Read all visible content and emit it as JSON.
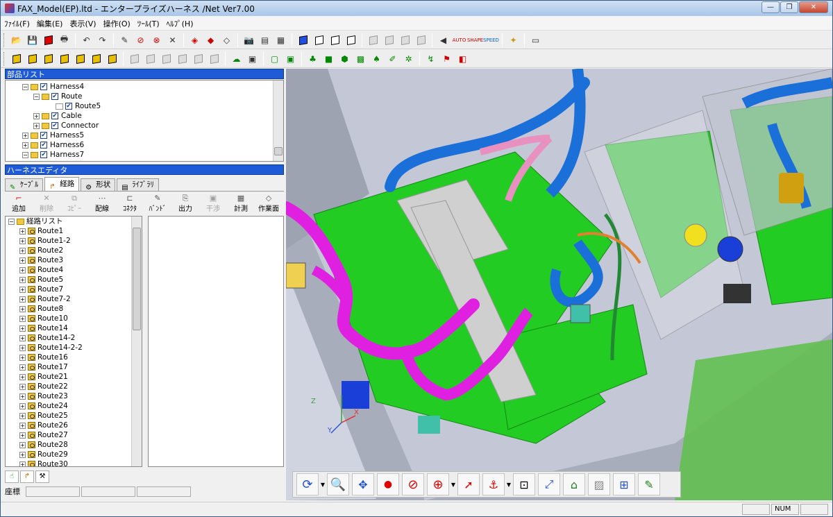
{
  "window": {
    "title": "FAX_Model(EP).ltd - エンタープライズハーネス /Net Ver7.00",
    "minimize": "—",
    "restore": "❐",
    "close": "✕"
  },
  "menu": [
    "ﾌｧｲﾙ(F)",
    "編集(E)",
    "表示(V)",
    "操作(O)",
    "ﾂｰﾙ(T)",
    "ﾍﾙﾌﾟ(H)"
  ],
  "parts_list": {
    "header": "部品リスト",
    "items": [
      {
        "label": "Harness4",
        "expand": "−",
        "indent": 24
      },
      {
        "label": "Route",
        "expand": "−",
        "indent": 40
      },
      {
        "label": "Route5",
        "expand": "",
        "indent": 72
      },
      {
        "label": "Cable",
        "expand": "+",
        "indent": 40
      },
      {
        "label": "Connector",
        "expand": "+",
        "indent": 40
      },
      {
        "label": "Harness5",
        "expand": "+",
        "indent": 24
      },
      {
        "label": "Harness6",
        "expand": "+",
        "indent": 24
      },
      {
        "label": "Harness7",
        "expand": "−",
        "indent": 24
      }
    ]
  },
  "harness_editor": {
    "header": "ハーネスエディタ",
    "tabs": [
      "ｹｰﾌﾞﾙ",
      "経路",
      "形状",
      "ﾗｲﾌﾞﾗﾘ"
    ],
    "tools": [
      {
        "label": "追加",
        "enabled": true,
        "icon": "add-route"
      },
      {
        "label": "削除",
        "enabled": false,
        "icon": "delete"
      },
      {
        "label": "ｺﾋﾟｰ",
        "enabled": false,
        "icon": "copy"
      },
      {
        "label": "配線",
        "enabled": true,
        "icon": "wiring"
      },
      {
        "label": "ｺﾈｸﾀ",
        "enabled": true,
        "icon": "connector"
      },
      {
        "label": "ﾊﾞﾝﾄﾞ",
        "enabled": true,
        "icon": "band"
      },
      {
        "label": "出力",
        "enabled": true,
        "icon": "output"
      },
      {
        "label": "干渉",
        "enabled": false,
        "icon": "interference"
      },
      {
        "label": "計測",
        "enabled": true,
        "icon": "measure"
      },
      {
        "label": "作業面",
        "enabled": true,
        "icon": "work-plane"
      }
    ],
    "route_list_root": "経路リスト",
    "routes": [
      "Route1",
      "Route1-2",
      "Route2",
      "Route3",
      "Route4",
      "Route5",
      "Route7",
      "Route7-2",
      "Route8",
      "Route10",
      "Route14",
      "Route14-2",
      "Route14-2-2",
      "Route16",
      "Route17",
      "Route21",
      "Route22",
      "Route23",
      "Route24",
      "Route25",
      "Route26",
      "Route27",
      "Route28",
      "Route29",
      "Route30"
    ]
  },
  "coords_label": "座標",
  "status": {
    "num": "NUM"
  },
  "axes": {
    "x": "X",
    "y": "Y",
    "z": "Z"
  },
  "colors": {
    "pcb": "#22cc22",
    "harness_blue": "#1a6fd8",
    "harness_magenta": "#e020e0",
    "harness_pink": "#e890c0",
    "tray": "#b8bcc8"
  }
}
